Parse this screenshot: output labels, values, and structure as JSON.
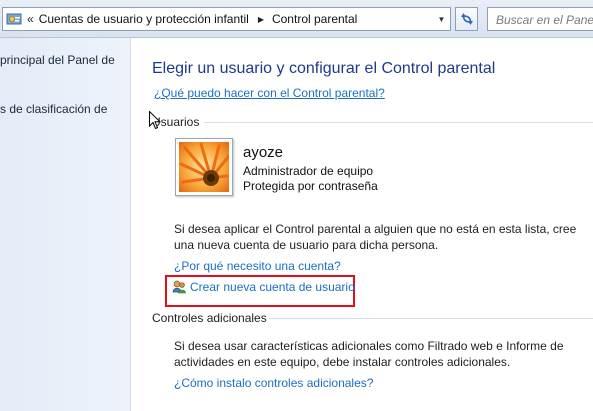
{
  "address_bar": {
    "crumb_chevrons": "«",
    "crumbs": [
      "Cuentas de usuario y protección infantil",
      "Control parental"
    ],
    "separator": "▶",
    "dropdown": "▼"
  },
  "search": {
    "placeholder": "Buscar en el Panel"
  },
  "left_nav": {
    "items": [
      {
        "label": " principal del Panel de"
      },
      {
        "label": "s de clasificación de"
      }
    ]
  },
  "main": {
    "title": "Elegir un usuario y configurar el Control parental",
    "help_link": "¿Qué puedo hacer con el Control parental?",
    "users_section": "Usuarios",
    "user": {
      "name": "ayoze",
      "role": "Administrador de equipo",
      "protection": "Protegida por contraseña"
    },
    "create_info": [
      "Si desea aplicar el Control parental a alguien que no está en esta lista, cree",
      "una nueva cuenta de usuario para dicha persona."
    ],
    "why_link": "¿Por qué necesito una cuenta?",
    "create_link": "Crear nueva cuenta de usuario",
    "controls_section": "Controles adicionales",
    "controls_info": [
      "Si desea usar características adicionales como Filtrado web e Informe de",
      "actividades en este equipo, debe instalar controles adicionales."
    ],
    "install_link": "¿Cómo instalo controles adicionales?"
  },
  "colors": {
    "title": "#1e3a8c",
    "link": "#1a6fc4",
    "highlight_box": "#e0101a"
  }
}
